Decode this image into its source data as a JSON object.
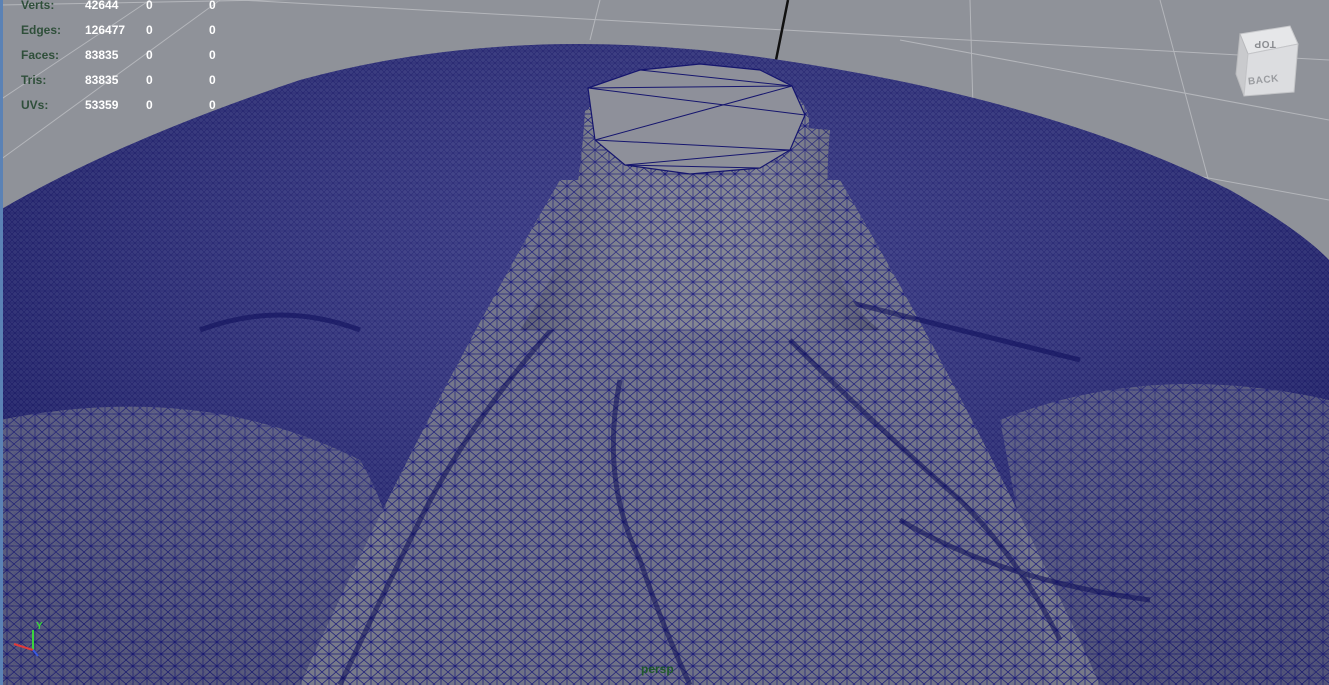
{
  "hud": {
    "rows": [
      {
        "label": "Verts:",
        "values": [
          "42644",
          "0",
          "0"
        ]
      },
      {
        "label": "Edges:",
        "values": [
          "126477",
          "0",
          "0"
        ]
      },
      {
        "label": "Faces:",
        "values": [
          "83835",
          "0",
          "0"
        ]
      },
      {
        "label": "Tris:",
        "values": [
          "83835",
          "0",
          "0"
        ]
      },
      {
        "label": "UVs:",
        "values": [
          "53359",
          "0",
          "0"
        ]
      }
    ]
  },
  "viewcube": {
    "top_face": "TOP",
    "back_face": "BACK"
  },
  "camera": {
    "name": "persp"
  },
  "axis": {
    "y_label": "Y"
  },
  "colors": {
    "background": "#8f9299",
    "grid": "#b7b9bd",
    "wire": "#1a1a7a",
    "surface": "#7b7d8a",
    "hud_label": "#2f4f3a",
    "hud_value": "#ffffff"
  },
  "icons": [
    "viewcube-icon",
    "axis-gizmo-icon"
  ]
}
